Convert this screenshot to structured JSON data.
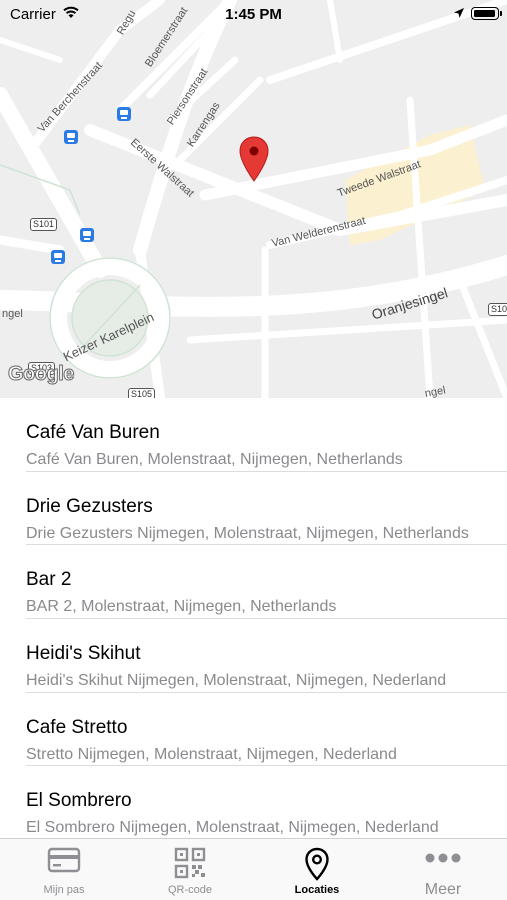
{
  "status_bar": {
    "carrier": "Carrier",
    "time": "1:45 PM"
  },
  "map": {
    "street_labels": {
      "regu": "Regu",
      "bloemerstraat": "Bloemerstraat",
      "van_berchenstraat": "Van Berchenstraat",
      "piersonstraat": "Piersonstraat",
      "karrengas": "Karrengas",
      "eerste_walstraat": "Eerste Walstraat",
      "tweede_walstraat": "Tweede Walstraat",
      "van_welderenstraat": "Van Welderenstraat",
      "oranjesingel": "Oranjesingel",
      "keizer_karelplein": "Keizer Karelplein",
      "singel": "ngel",
      "lower_right": "ngel"
    },
    "route_shields": {
      "s101": "S101",
      "s105": "S105",
      "s10_right": "S10",
      "s103": "S103"
    },
    "google_logo": "Google",
    "pin_color": "#e53935"
  },
  "locations": [
    {
      "name": "Café Van Buren",
      "address": "Café Van Buren, Molenstraat, Nijmegen, Netherlands"
    },
    {
      "name": "Drie Gezusters",
      "address": "Drie Gezusters Nijmegen, Molenstraat, Nijmegen, Netherlands"
    },
    {
      "name": "Bar 2",
      "address": "BAR 2, Molenstraat, Nijmegen, Netherlands"
    },
    {
      "name": "Heidi's Skihut",
      "address": "Heidi's Skihut Nijmegen, Molenstraat, Nijmegen, Nederland"
    },
    {
      "name": "Cafe Stretto",
      "address": "Stretto Nijmegen, Molenstraat, Nijmegen, Nederland"
    },
    {
      "name": "El Sombrero",
      "address": "El Sombrero Nijmegen, Molenstraat, Nijmegen, Nederland"
    }
  ],
  "tab_bar": {
    "tabs": [
      {
        "label": "Mijn pas",
        "icon": "card-icon"
      },
      {
        "label": "QR-code",
        "icon": "qr-code-icon"
      },
      {
        "label": "Locaties",
        "icon": "location-pin-icon",
        "active": true
      },
      {
        "label": "Meer",
        "icon": "more-dots-icon"
      }
    ],
    "active_color": "#000000",
    "inactive_color": "#8e8e93"
  }
}
